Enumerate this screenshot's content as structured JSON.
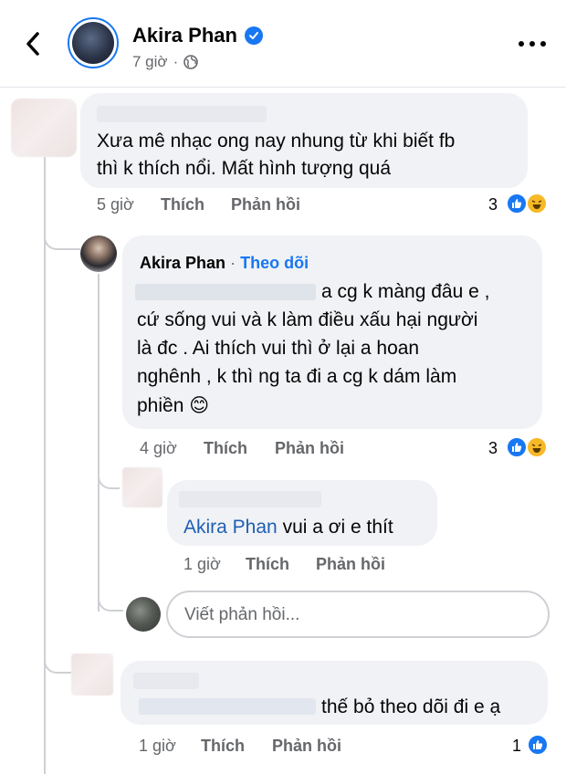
{
  "header": {
    "name": "Akira Phan",
    "time": "7 giờ",
    "separator": "·"
  },
  "comments": [
    {
      "text_line1": "Xưa mê nhạc ong nay nhung từ khi biết fb",
      "text_line2": "thì k thích nổi. Mất hình tượng quá",
      "time": "5 giờ",
      "like_label": "Thích",
      "reply_label": "Phản hồi",
      "reaction_count": "3"
    }
  ],
  "replies": [
    {
      "author": "Akira Phan",
      "separator": "·",
      "follow_label": "Theo dõi",
      "line1": "a cg k màng đâu e ,",
      "line2": "cứ sống vui và k làm điều xấu hại người",
      "line3": "là đc . Ai thích vui thì ở lại a hoan",
      "line4": "nghênh , k thì ng ta đi a cg k dám làm",
      "line5": "phiền",
      "emoji": "😊",
      "time": "4 giờ",
      "like_label": "Thích",
      "reply_label": "Phản hồi",
      "reaction_count": "3"
    },
    {
      "mention": "Akira Phan",
      "text": " vui a ơi e thít",
      "time": "1 giờ",
      "like_label": "Thích",
      "reply_label": "Phản hồi"
    },
    {
      "text": "thế bỏ theo dõi đi e ạ",
      "time": "1 giờ",
      "like_label": "Thích",
      "reply_label": "Phản hồi",
      "reaction_count": "1"
    }
  ],
  "reply_input": {
    "placeholder": "Viết phản hồi..."
  },
  "icons": {
    "back": "chevron-left-icon",
    "more": "more-horizontal-icon",
    "verified": "verified-badge-icon",
    "globe": "globe-icon",
    "like": "like-reaction-icon",
    "haha": "haha-reaction-icon"
  },
  "colors": {
    "accent": "#1877f2",
    "bubble": "#f0f2f5",
    "muted_text": "#65676b"
  }
}
